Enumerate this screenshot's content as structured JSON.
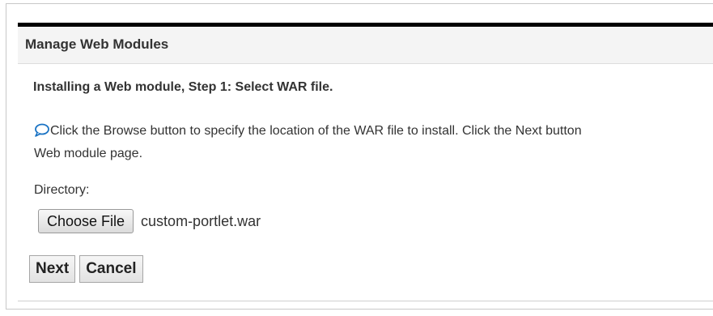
{
  "header": {
    "title": "Manage Web Modules"
  },
  "step": {
    "title": "Installing a Web module, Step 1: Select WAR file."
  },
  "help": {
    "icon": "help-bubble-icon",
    "line1": "Click the Browse button to specify the location of the WAR file to install. Click the Next button",
    "line2": "Web module page."
  },
  "form": {
    "directory_label": "Directory:",
    "choose_file_label": "Choose File",
    "selected_file": "custom-portlet.war"
  },
  "actions": {
    "next_label": "Next",
    "cancel_label": "Cancel"
  },
  "colors": {
    "top_bar": "#000000",
    "header_background": "#f4f4f4",
    "help_icon": "#1a73c4"
  }
}
